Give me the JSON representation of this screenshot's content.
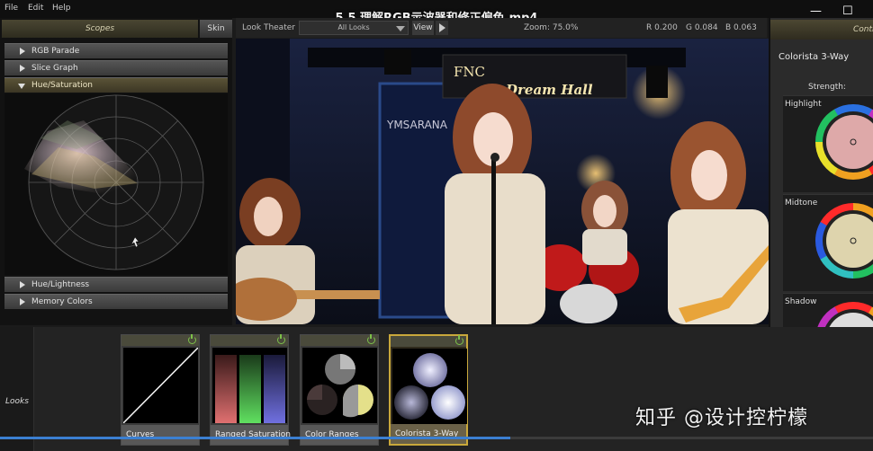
{
  "window": {
    "title": "5.5 理解RGB示波器和修正偏色.mp4",
    "menu": [
      "File",
      "Edit",
      "Help"
    ],
    "minimize_glyph": "—",
    "maximize_glyph": "☐"
  },
  "scopes": {
    "header": "Scopes",
    "skin_button": "Skin",
    "items": [
      {
        "label": "RGB Parade",
        "expanded": false
      },
      {
        "label": "Slice Graph",
        "expanded": false
      },
      {
        "label": "Hue/Saturation",
        "expanded": true
      },
      {
        "label": "Hue/Lightness",
        "expanded": false
      },
      {
        "label": "Memory Colors",
        "expanded": false
      }
    ]
  },
  "viewer_toolbar": {
    "look_theater": "Look Theater",
    "looks_select": "All Looks",
    "view_button": "View",
    "zoom": "Zoom:  75.0%",
    "r": "R 0.200",
    "g": "G 0.084",
    "b": "B 0.063"
  },
  "viewer": {
    "sign_text": "FNC",
    "sign_text2": "Dream Hall",
    "window_text": "YMSARANA"
  },
  "controls": {
    "header": "Controls",
    "title": "Colorista 3-Way",
    "strength_label": "Strength:",
    "wheels": [
      {
        "label": "Highlight"
      },
      {
        "label": "Midtone"
      },
      {
        "label": "Shadow"
      }
    ]
  },
  "looks_bin": {
    "side_label": "Looks",
    "cards": [
      {
        "label": "Curves",
        "selected": false
      },
      {
        "label": "Ranged Saturation",
        "selected": false
      },
      {
        "label": "Color Ranges",
        "selected": false
      },
      {
        "label": "Colorista 3-Way",
        "selected": true
      }
    ]
  },
  "watermark": "知乎 @设计控柠檬",
  "playback": {
    "progress": 0.585
  },
  "colors": {
    "accent": "#c9a83b",
    "progress": "#3b7fd1",
    "panel_header": "#4a4632"
  }
}
